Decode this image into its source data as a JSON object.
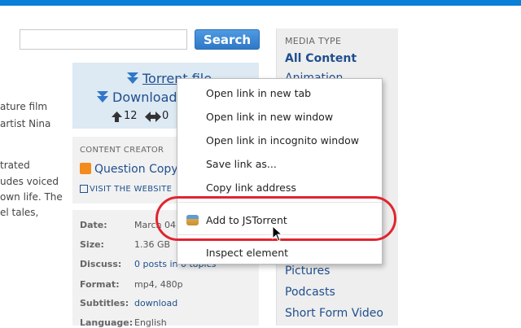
{
  "search": {
    "button_label": "Search",
    "value": ""
  },
  "left_fragments": [
    "ature film",
    "artist Nina",
    "trated",
    "udes voiced",
    "own life. The",
    "el tales,"
  ],
  "torrent": {
    "torrent_label": "Torrent file",
    "download_label": "Download v",
    "seeds": "12",
    "peers": "0"
  },
  "creator": {
    "title": "CONTENT CREATOR",
    "name": "Question Copyri",
    "visit": "VISIT THE WEBSITE"
  },
  "meta": [
    {
      "key": "Date:",
      "value": "March 04, 2",
      "link": false
    },
    {
      "key": "Size:",
      "value": "1.36 GB",
      "link": false
    },
    {
      "key": "Discuss:",
      "value": "0 posts in 0 topics",
      "link": true
    },
    {
      "key": "Format:",
      "value": "mp4, 480p",
      "link": false
    },
    {
      "key": "Subtitles:",
      "value": "download",
      "link": true
    },
    {
      "key": "Language:",
      "value": "English",
      "link": false
    }
  ],
  "sidebar": {
    "heading": "MEDIA TYPE",
    "items": [
      "All Content",
      "Animation",
      "Pictures",
      "Podcasts",
      "Short Form Video"
    ]
  },
  "context_menu": {
    "items": [
      "Open link in new tab",
      "Open link in new window",
      "Open link in incognito window",
      "Save link as...",
      "Copy link address",
      "Add to JSTorrent",
      "Inspect element"
    ]
  },
  "colors": {
    "accent": "#0a7fd7",
    "link": "#1f4f8e",
    "highlight": "#e02530"
  }
}
